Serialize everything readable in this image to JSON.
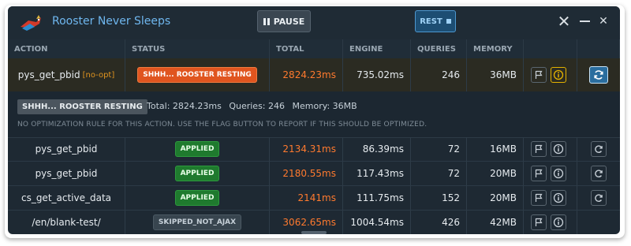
{
  "app": {
    "title": "Rooster Never Sleeps"
  },
  "toolbar": {
    "pause_label": "PAUSE",
    "rest_label": "REST"
  },
  "window_controls": {
    "close_large": "✕",
    "close_small": "✕"
  },
  "columns": [
    "ACTION",
    "STATUS",
    "TOTAL",
    "ENGINE",
    "QUERIES",
    "MEMORY"
  ],
  "rows": [
    {
      "action": "pys_get_pbid",
      "tag": "[no-opt]",
      "status": "SHHH... ROOSTER RESTING",
      "total": "2824.23ms",
      "engine": "735.02ms",
      "queries": "246",
      "memory": "36MB"
    },
    {
      "action": "pys_get_pbid",
      "status": "APPLIED",
      "total": "2134.31ms",
      "engine": "86.39ms",
      "queries": "72",
      "memory": "16MB"
    },
    {
      "action": "pys_get_pbid",
      "status": "APPLIED",
      "total": "2180.55ms",
      "engine": "117.43ms",
      "queries": "72",
      "memory": "20MB"
    },
    {
      "action": "cs_get_active_data",
      "status": "APPLIED",
      "total": "2141ms",
      "engine": "111.75ms",
      "queries": "152",
      "memory": "20MB"
    },
    {
      "action": "/en/blank-test/",
      "status": "SKIPPED_NOT_AJAX",
      "total": "3062.65ms",
      "engine": "1004.54ms",
      "queries": "426",
      "memory": "42MB"
    }
  ],
  "detail": {
    "badge": "SHHH... ROOSTER RESTING",
    "total": "Total: 2824.23ms",
    "queries": "Queries: 246",
    "memory": "Memory: 36MB",
    "note": "NO OPTIMIZATION RULE FOR THIS ACTION. USE THE FLAG BUTTON TO REPORT IF THIS SHOULD BE OPTIMIZED."
  },
  "colors": {
    "accent": "#6fb7ef",
    "orange": "#ff7a2e",
    "applied": "#1f7a2e",
    "resting": "#e0551f",
    "background": "#1e2933"
  },
  "icons": {
    "logo": "rooster-logo-icon",
    "flag": "flag-icon",
    "info": "info-icon",
    "refresh": "refresh-icon"
  }
}
